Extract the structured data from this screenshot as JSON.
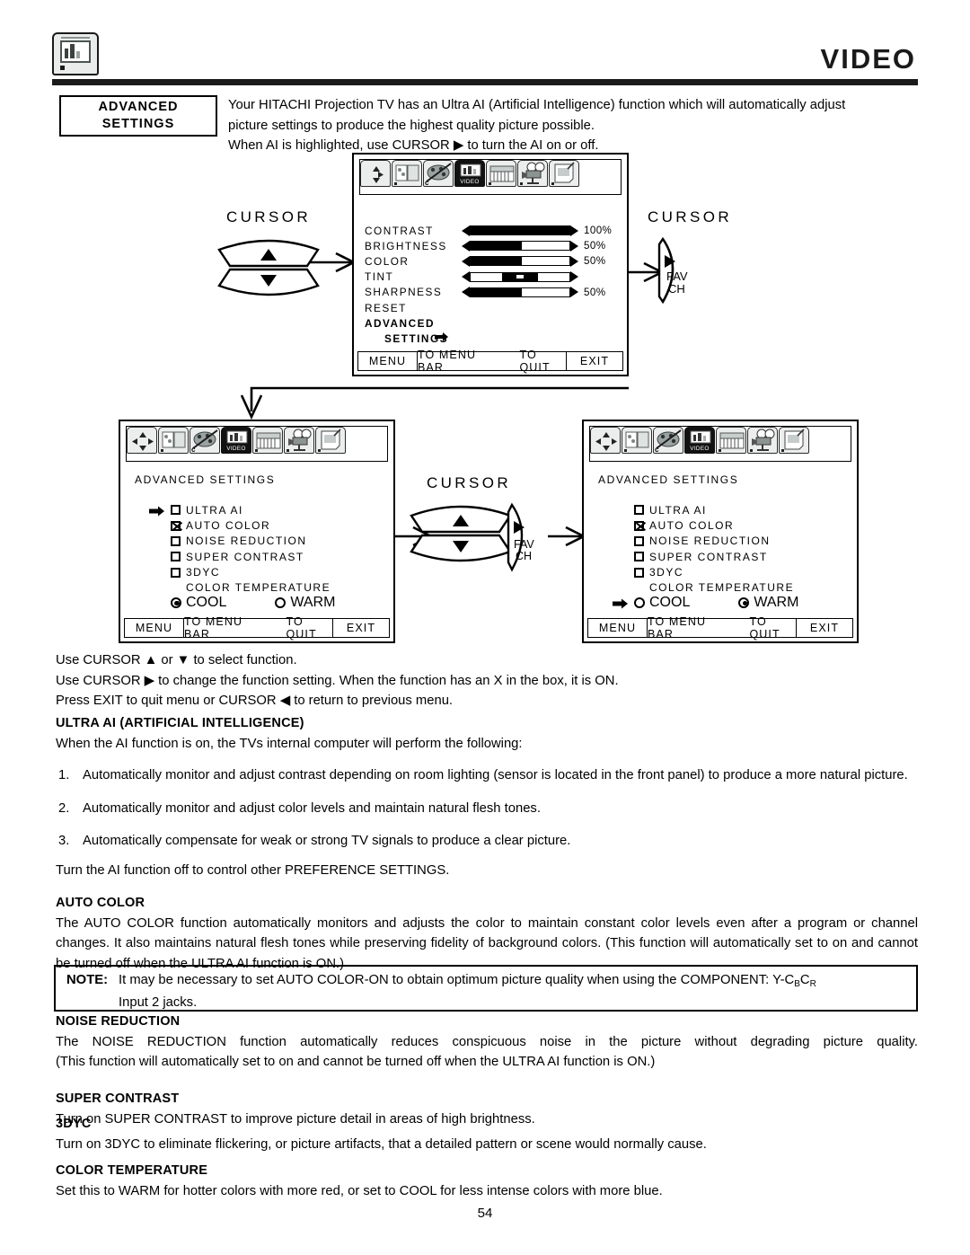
{
  "header": {
    "title": "VIDEO",
    "icon": "tv-video-icon"
  },
  "intro": {
    "box_line1": "ADVANCED",
    "box_line2": "SETTINGS",
    "paragraph_line1": "Your HITACHI Projection TV has an Ultra AI (Artificial Intelligence) function which will automatically adjust",
    "paragraph_line2": "picture settings to produce the highest quality picture possible.",
    "paragraph_line3": "When AI is highlighted, use CURSOR ▶ to turn the AI on or off."
  },
  "osd_video": {
    "selected_tab": "VIDEO",
    "rows": [
      {
        "name": "CONTRAST",
        "value": "100%",
        "fill": 100
      },
      {
        "name": "BRIGHTNESS",
        "value": "50%",
        "fill": 50
      },
      {
        "name": "COLOR",
        "value": "50%",
        "fill": 50
      },
      {
        "name": "TINT",
        "value": "",
        "fill": 50
      },
      {
        "name": "SHARPNESS",
        "value": "50%",
        "fill": 50
      },
      {
        "name": "RESET",
        "value": "",
        "fill": null
      }
    ],
    "advanced_label": "ADVANCED",
    "settings_label": "SETTINGS",
    "bottom_bar": {
      "menu": "MENU",
      "to_menu_bar": "TO MENU BAR",
      "to_quit": "TO QUIT",
      "exit": "EXIT"
    }
  },
  "osd_adv_left": {
    "selected_tab": "VIDEO",
    "title": "ADVANCED SETTINGS",
    "items": [
      {
        "label": "ULTRA AI",
        "checked": false,
        "pointer": true
      },
      {
        "label": "AUTO COLOR",
        "checked": true,
        "pointer": false
      },
      {
        "label": "NOISE REDUCTION",
        "checked": false,
        "pointer": false
      },
      {
        "label": "SUPER CONTRAST",
        "checked": false,
        "pointer": false
      },
      {
        "label": "3DYC",
        "checked": false,
        "pointer": false
      }
    ],
    "color_temperature_label": "COLOR TEMPERATURE",
    "cool_label": "COOL",
    "warm_label": "WARM",
    "cool_selected": true,
    "warm_selected": false,
    "temp_pointer": false,
    "bottom_bar": {
      "menu": "MENU",
      "to_menu_bar": "TO MENU BAR",
      "to_quit": "TO QUIT",
      "exit": "EXIT"
    }
  },
  "osd_adv_right": {
    "selected_tab": "VIDEO",
    "title": "ADVANCED SETTINGS",
    "items": [
      {
        "label": "ULTRA AI",
        "checked": false,
        "pointer": false
      },
      {
        "label": "AUTO COLOR",
        "checked": true,
        "pointer": false
      },
      {
        "label": "NOISE REDUCTION",
        "checked": false,
        "pointer": false
      },
      {
        "label": "SUPER CONTRAST",
        "checked": false,
        "pointer": false
      },
      {
        "label": "3DYC",
        "checked": false,
        "pointer": false
      }
    ],
    "color_temperature_label": "COLOR TEMPERATURE",
    "cool_label": "COOL",
    "warm_label": "WARM",
    "cool_selected": false,
    "warm_selected": true,
    "temp_pointer": true,
    "bottom_bar": {
      "menu": "MENU",
      "to_menu_bar": "TO MENU BAR",
      "to_quit": "TO QUIT",
      "exit": "EXIT"
    }
  },
  "cursors": {
    "caption": "CURSOR",
    "fav_line1": "FAV",
    "fav_line2": "CH"
  },
  "instructions": {
    "line1": "Use CURSOR ▲ or ▼ to select function.",
    "line2": "Use CURSOR ▶ to change the function setting. When the function has an  X  in the box, it is ON.",
    "line3": "Press EXIT to quit menu or CURSOR ◀ to return to previous menu."
  },
  "sections": {
    "ultra_ai": {
      "heading": "ULTRA AI (ARTIFICIAL INTELLIGENCE)",
      "intro": "When the AI function is on, the TVs  internal computer will perform the following:",
      "list": [
        {
          "n": "1.",
          "text": "Automatically monitor and adjust contrast depending on room lighting (sensor is located in the front panel) to produce a more natural picture."
        },
        {
          "n": "2.",
          "text": "Automatically monitor and adjust color levels and maintain natural flesh tones."
        },
        {
          "n": "3.",
          "text": "Automatically compensate for weak or strong TV signals to produce a clear picture."
        }
      ],
      "closing": "Turn the AI function off to control other PREFERENCE SETTINGS."
    },
    "auto_color": {
      "heading": "AUTO COLOR",
      "body": "The AUTO COLOR function automatically monitors and adjusts the color to maintain constant color levels even after a program or channel changes. It also maintains natural flesh tones while preserving fidelity of background colors. (This function will automatically set to on and cannot be turned off when the ULTRA AI function is ON.)"
    },
    "note": {
      "label": "NOTE:",
      "line1_pre": "It may be necessary to set AUTO COLOR-ON to obtain optimum picture quality when using the COMPONENT: Y-C",
      "line1_sub1": "B",
      "line1_mid": "C",
      "line1_sub2": "R",
      "line2": "Input 2 jacks."
    },
    "noise_reduction": {
      "heading": "NOISE REDUCTION",
      "body_line1": "The NOISE REDUCTION function automatically reduces conspicuous noise in the picture without degrading picture quality.",
      "body_line2": "(This function will automatically set to on and cannot be turned off when the ULTRA AI function is ON.)"
    },
    "super_contrast": {
      "heading": "SUPER CONTRAST",
      "body": "Turn on SUPER CONTRAST to improve picture detail in areas of high brightness."
    },
    "threedyc": {
      "heading": "3DYC",
      "body": "Turn on 3DYC to eliminate flickering, or picture artifacts, that a detailed pattern or scene would normally cause."
    },
    "color_temperature": {
      "heading": "COLOR TEMPERATURE",
      "body": "Set this to WARM for hotter colors with more red, or set to COOL for less intense colors with more blue."
    }
  },
  "page_number": "54"
}
